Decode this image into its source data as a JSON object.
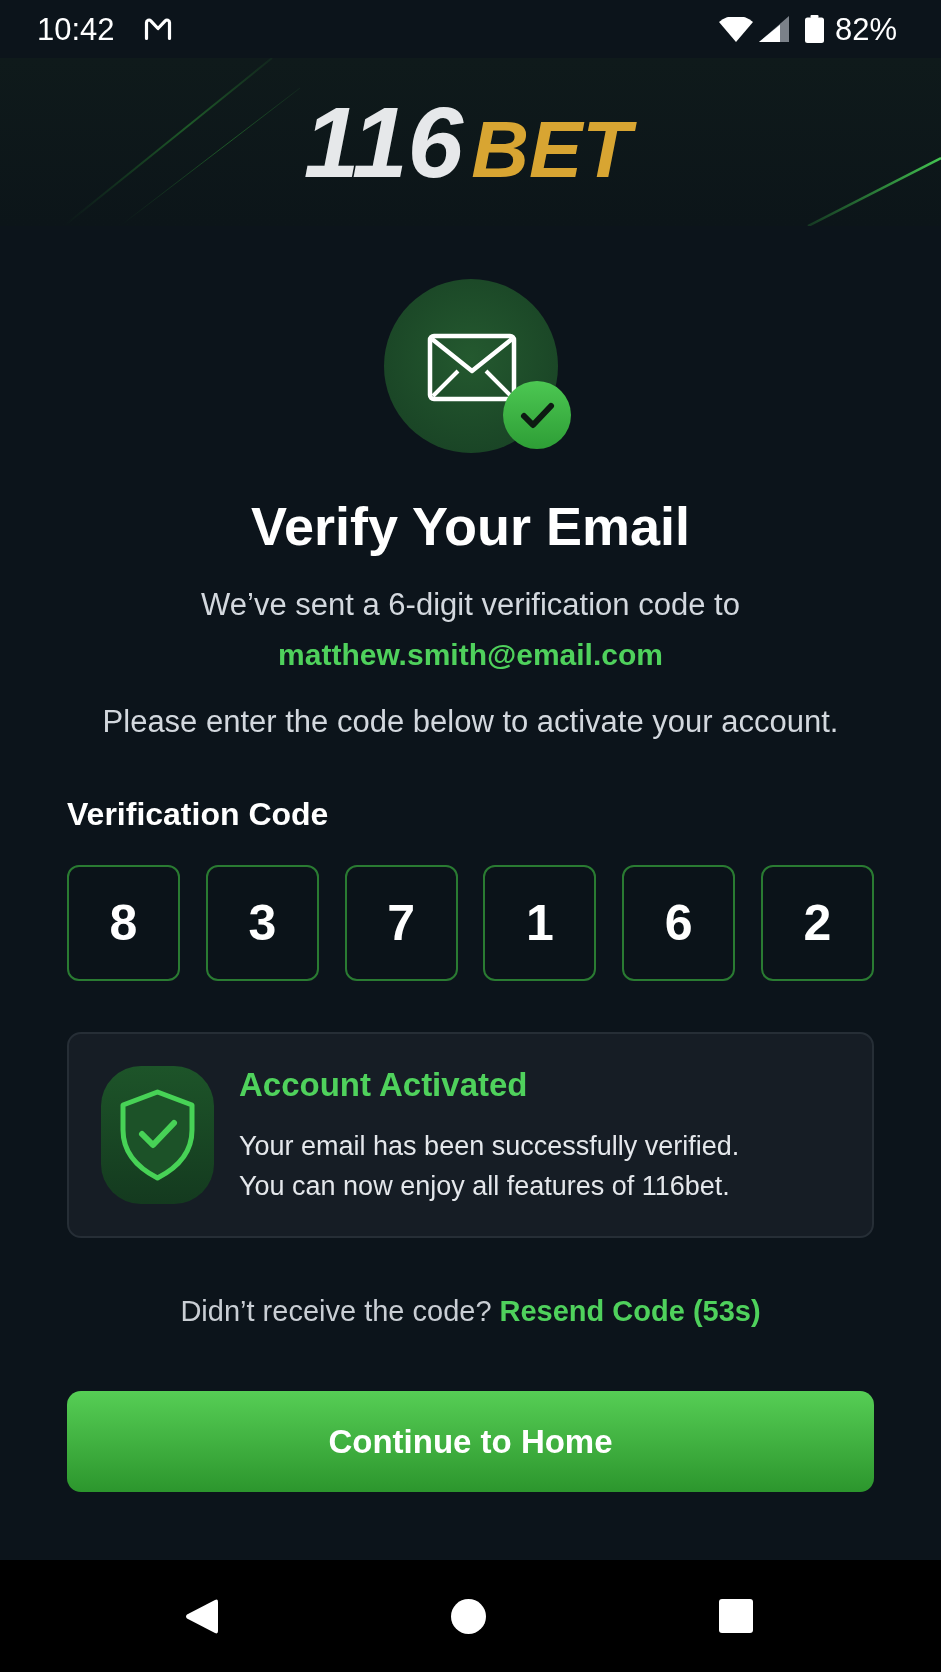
{
  "status_bar": {
    "time": "10:42",
    "battery": "82%"
  },
  "logo": {
    "text": "116",
    "accent": "BET"
  },
  "heading": "Verify Your Email",
  "message": {
    "line": "We’ve sent a 6-digit verification code to",
    "email": "matthew.smith@email.com",
    "instruction": "Please enter the code below to activate your account."
  },
  "code": {
    "label": "Verification Code",
    "digits": [
      "8",
      "3",
      "7",
      "1",
      "6",
      "2"
    ]
  },
  "alert": {
    "title": "Account Activated",
    "lines": [
      "Your email has been successfully verified.",
      "You can now enjoy all features of 116bet."
    ]
  },
  "resend": {
    "prompt": "Didn’t receive the code?",
    "link": "Resend Code (53s)"
  },
  "primary_button": "Continue to Home"
}
